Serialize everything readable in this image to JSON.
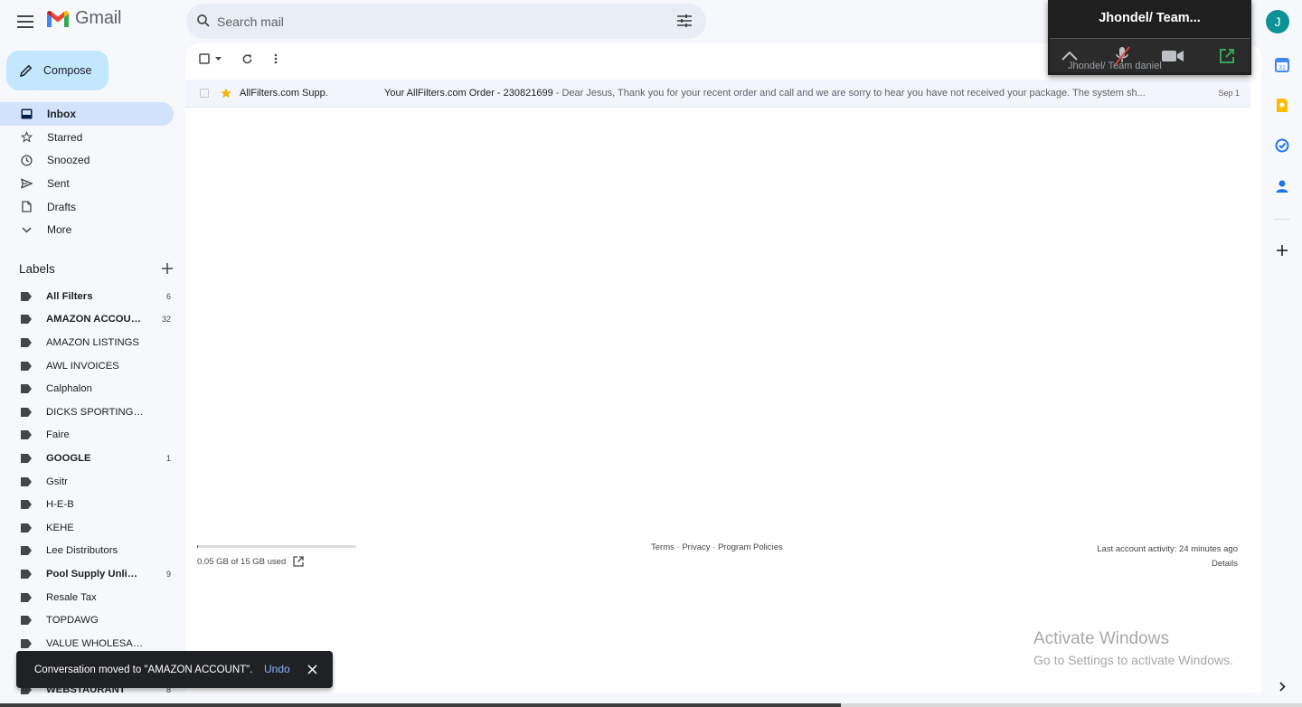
{
  "header": {
    "app_name": "Gmail",
    "search_placeholder": "Search mail",
    "avatar_letter": "J"
  },
  "compose": {
    "label": "Compose"
  },
  "nav": {
    "items": [
      {
        "label": "Inbox",
        "icon": "inbox-icon",
        "active": true
      },
      {
        "label": "Starred",
        "icon": "star-icon"
      },
      {
        "label": "Snoozed",
        "icon": "clock-icon"
      },
      {
        "label": "Sent",
        "icon": "send-icon"
      },
      {
        "label": "Drafts",
        "icon": "draft-icon"
      },
      {
        "label": "More",
        "icon": "chevron-down-icon"
      }
    ]
  },
  "labels": {
    "title": "Labels",
    "items": [
      {
        "name": "All Filters",
        "count": "6",
        "bold": true
      },
      {
        "name": "AMAZON ACCOUNT",
        "count": "32",
        "bold": true
      },
      {
        "name": "AMAZON LISTINGS",
        "count": ""
      },
      {
        "name": "AWL INVOICES",
        "count": ""
      },
      {
        "name": "Calphalon",
        "count": ""
      },
      {
        "name": "DICKS SPORTING GOODS",
        "count": ""
      },
      {
        "name": "Faire",
        "count": ""
      },
      {
        "name": "GOOGLE",
        "count": "1",
        "bold": true
      },
      {
        "name": "Gsitr",
        "count": ""
      },
      {
        "name": "H-E-B",
        "count": ""
      },
      {
        "name": "KEHE",
        "count": ""
      },
      {
        "name": "Lee Distributors",
        "count": ""
      },
      {
        "name": "Pool Supply Unlimited",
        "count": "9",
        "bold": true
      },
      {
        "name": "Resale Tax",
        "count": ""
      },
      {
        "name": "TOPDAWG",
        "count": ""
      },
      {
        "name": "VALUE WHOLESALE",
        "count": ""
      },
      {
        "name": "",
        "count": ""
      },
      {
        "name": "WEBSTAURANT",
        "count": "8",
        "bold": true
      }
    ]
  },
  "emails": [
    {
      "sender": "AllFilters.com Supp.",
      "subject": "Your AllFilters.com Order - 230821699",
      "snippet": " - Dear Jesus, Thank you for your recent order and call and we are sorry to hear you have not received your package. The system sh...",
      "date": "Sep 1",
      "starred": true
    }
  ],
  "footer": {
    "storage": "0.05 GB of 15 GB used",
    "storage_fraction": 0.0033,
    "terms": "Terms",
    "privacy": "Privacy",
    "policies": "Program Policies",
    "sep": " · ",
    "activity": "Last account activity: 24 minutes ago",
    "details": "Details"
  },
  "watermark": {
    "line1": "Activate Windows",
    "line2": "Go to Settings to activate Windows."
  },
  "meeting": {
    "title": "Jhondel/ Team...",
    "participant": "Jhondel/ Team daniel"
  },
  "snackbar": {
    "message": "Conversation moved to \"AMAZON ACCOUNT\".",
    "undo": "Undo"
  },
  "colors": {
    "accent": "#0b57d0",
    "compose_bg": "#c2e7ff",
    "active_nav": "#d3e3fd",
    "star": "#f4b400"
  }
}
